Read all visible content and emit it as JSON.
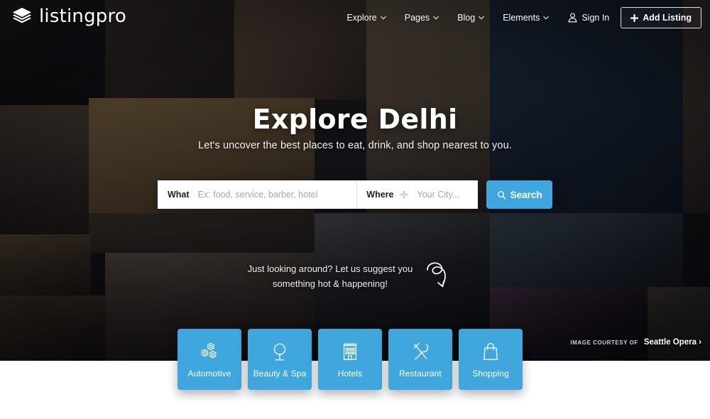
{
  "header": {
    "logo_text": "listingpro",
    "logo_icon": "layers-icon",
    "nav": [
      {
        "label": "Explore",
        "icon": "chevron-down-icon"
      },
      {
        "label": "Pages",
        "icon": "chevron-down-icon"
      },
      {
        "label": "Blog",
        "icon": "chevron-down-icon"
      },
      {
        "label": "Elements",
        "icon": "chevron-down-icon"
      }
    ],
    "sign_in": {
      "label": "Sign In",
      "icon": "user-icon"
    },
    "add_listing": {
      "label": "Add Listing",
      "icon": "plus-icon"
    }
  },
  "hero": {
    "headline": "Explore Delhi",
    "subline": "Let's uncover the best places to eat, drink, and shop nearest to you.",
    "suggest_text": "Just looking around? Let us suggest you something hot & happening!",
    "suggest_icon": "curved-arrow-icon",
    "courtesy_label": "IMAGE COURTESY OF",
    "courtesy_name": "Seattle Opera ›"
  },
  "search": {
    "what_label": "What",
    "what_placeholder": "Ex: food, service, barber, hotel",
    "what_value": "",
    "where_label": "Where",
    "where_icon": "locate-crosshair-icon",
    "where_placeholder": "Your City...",
    "where_value": "",
    "button_label": "Search",
    "button_icon": "magnifier-icon"
  },
  "categories": [
    {
      "label": "Automotive",
      "icon": "gears-icon"
    },
    {
      "label": "Beauty & Spa",
      "icon": "mirror-icon"
    },
    {
      "label": "Hotels",
      "icon": "building-icon"
    },
    {
      "label": "Restaurant",
      "icon": "fork-spoon-icon"
    },
    {
      "label": "Shopping",
      "icon": "shopping-bag-icon"
    }
  ],
  "colors": {
    "accent": "#3fa7dd",
    "hero_overlay": "#0a0c16",
    "page_background": "#ffffff",
    "text_light": "#ffffff"
  }
}
